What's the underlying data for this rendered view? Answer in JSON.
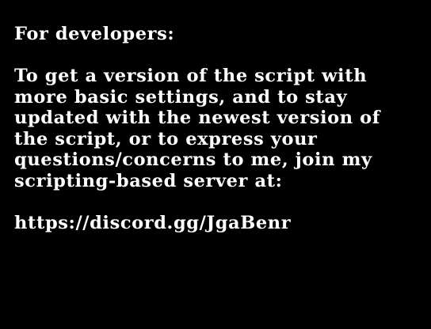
{
  "message": {
    "heading": "For developers:",
    "body_lines": [
      "To get a version of the script with",
      "more basic settings, and to stay",
      "updated with the newest version of",
      "the script, or to express your",
      "questions/concerns to me, join my",
      "scripting-based server at:"
    ],
    "link": "https://discord.gg/JgaBenr"
  },
  "colors": {
    "background": "#000000",
    "text": "#ffffff"
  }
}
